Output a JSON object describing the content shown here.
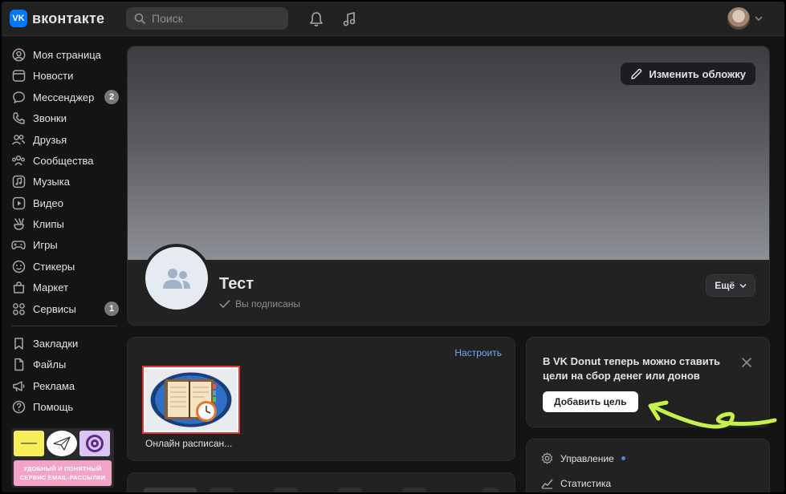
{
  "header": {
    "logo_text": "вконтакте",
    "logo_mark": "VK",
    "search_placeholder": "Поиск",
    "icons": [
      "search-icon",
      "bell-icon",
      "music-icon",
      "chevron-down-icon"
    ]
  },
  "sidebar": {
    "items": [
      {
        "label": "Моя страница",
        "icon": "user-circle-icon"
      },
      {
        "label": "Новости",
        "icon": "news-icon"
      },
      {
        "label": "Мессенджер",
        "icon": "message-icon",
        "badge": "2"
      },
      {
        "label": "Звонки",
        "icon": "phone-icon"
      },
      {
        "label": "Друзья",
        "icon": "friends-icon"
      },
      {
        "label": "Сообщества",
        "icon": "communities-icon"
      },
      {
        "label": "Музыка",
        "icon": "music-icon"
      },
      {
        "label": "Видео",
        "icon": "video-icon"
      },
      {
        "label": "Клипы",
        "icon": "clips-icon"
      },
      {
        "label": "Игры",
        "icon": "gamepad-icon"
      },
      {
        "label": "Стикеры",
        "icon": "smile-icon"
      },
      {
        "label": "Маркет",
        "icon": "bag-icon"
      },
      {
        "label": "Сервисы",
        "icon": "grid-icon",
        "badge": "1"
      }
    ],
    "secondary_items": [
      {
        "label": "Закладки",
        "icon": "bookmark-icon"
      },
      {
        "label": "Файлы",
        "icon": "file-icon"
      },
      {
        "label": "Реклама",
        "icon": "megaphone-icon"
      },
      {
        "label": "Помощь",
        "icon": "help-icon"
      }
    ],
    "ad": {
      "line1": "УДОБНЫЙ И ПОНЯТНЫЙ",
      "line2": "СЕРВИС EMAIL-РАССЫЛКИ"
    }
  },
  "profile": {
    "edit_cover_label": "Изменить обложку",
    "group_name": "Тест",
    "subscribed_label": "Вы подписаны",
    "more_label": "Ещё"
  },
  "apps": {
    "configure_label": "Настроить",
    "app_label": "Онлайн расписан..."
  },
  "donut": {
    "text": "В VK Donut теперь можно ставить цели на сбор денег или донов",
    "button_label": "Добавить цель"
  },
  "manage": {
    "items": [
      {
        "label": "Управление",
        "icon": "gear-icon"
      },
      {
        "label": "Статистика",
        "icon": "chart-icon"
      }
    ]
  },
  "colors": {
    "accent": "#0077ff",
    "link": "#71aaeb",
    "background": "#141414",
    "card": "#222222",
    "annotation_arrow": "#c6f04a"
  }
}
